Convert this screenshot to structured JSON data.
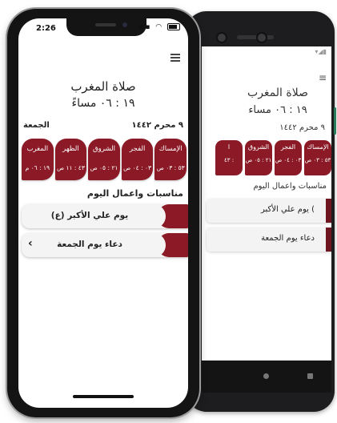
{
  "back_device": {
    "title": "صلاة المغرب",
    "time": "١٩ : ٠٦ مساء",
    "date": "٩ محرم ١٤٤٢",
    "cards": [
      {
        "name": "الإمساك",
        "time": "٥٣ : ٠٣ ص"
      },
      {
        "name": "الفجر",
        "time": "٠٣ : ٠٤ ص"
      },
      {
        "name": "الشروق",
        "time": "٢١ : ٠٥ ص"
      },
      {
        "name": "ا",
        "time": "٤٣ :"
      }
    ],
    "events_header": "مناسبات واعمال اليوم",
    "events": [
      "يوم علي الأكبر (",
      "دعاء يوم الجمعة"
    ]
  },
  "status_bar": {
    "time": "2:26"
  },
  "header": {
    "prayer_title": "صلاة المغرب",
    "prayer_time": "١٩ : ٠٦ مساءً"
  },
  "date_row": {
    "day": "الجمعة",
    "hijri": "٩ محرم ١٤٤٢"
  },
  "prayer_cards": [
    {
      "name": "الإمساك",
      "time": "٥٣ : ٠٣ ص"
    },
    {
      "name": "الفجر",
      "time": "٠٣ : ٠٤ ص"
    },
    {
      "name": "الشروق",
      "time": "٢١ : ٠٥ ص"
    },
    {
      "name": "الظهر",
      "time": "٤٣ : ١١ ص"
    },
    {
      "name": "المغرب",
      "time": "١٩ : ٠٦ م"
    }
  ],
  "events": {
    "header": "مناسبات واعمال اليوم",
    "items": [
      {
        "label": "يوم علي الأكبر (ع)",
        "chevron": ""
      },
      {
        "label": "دعاء يوم الجمعة",
        "chevron": "‹"
      }
    ]
  },
  "colors": {
    "accent": "#8b1a26",
    "accent_dark": "#6e1620"
  }
}
